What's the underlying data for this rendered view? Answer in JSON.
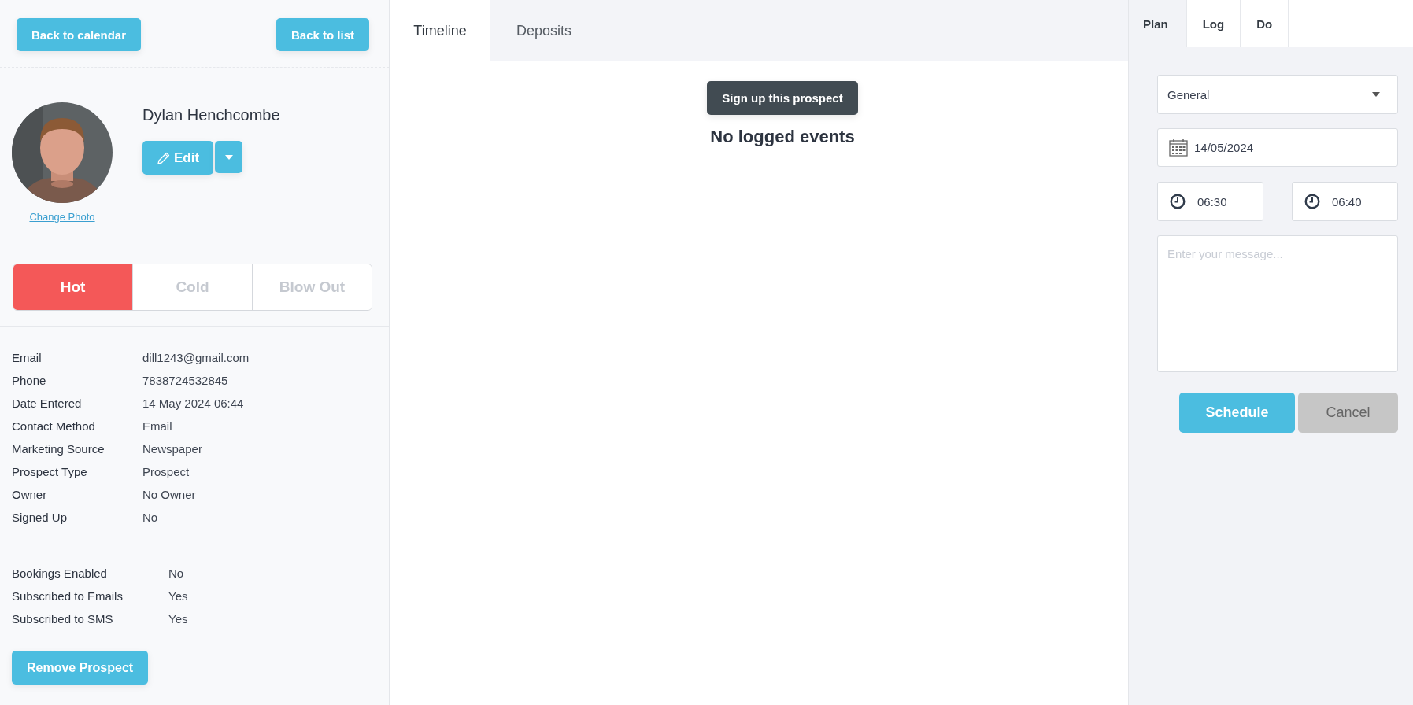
{
  "nav_buttons": [
    {
      "label": "Back to calendar"
    },
    {
      "label": "Back to list"
    }
  ],
  "profile": {
    "name": "Dylan Henchcombe",
    "edit_button": "Edit",
    "change_photo_link": "Change Photo"
  },
  "temperature": [
    {
      "label": "Hot",
      "selected": true
    },
    {
      "label": "Cold",
      "selected": false
    },
    {
      "label": "Blow Out",
      "selected": false
    }
  ],
  "details": [
    {
      "label": "Email",
      "value": "dill1243@gmail.com"
    },
    {
      "label": "Phone",
      "value": "7838724532845"
    },
    {
      "label": "Date Entered",
      "value": "14 May 2024 06:44"
    },
    {
      "label": "Contact Method",
      "value": "Email"
    },
    {
      "label": "Marketing Source",
      "value": "Newspaper"
    },
    {
      "label": "Prospect Type",
      "value": "Prospect"
    },
    {
      "label": "Owner",
      "value": "No Owner"
    },
    {
      "label": "Signed Up",
      "value": "No"
    }
  ],
  "settings": [
    {
      "label": "Bookings Enabled",
      "value": "No"
    },
    {
      "label": "Subscribed to Emails",
      "value": "Yes"
    },
    {
      "label": "Subscribed to SMS",
      "value": "Yes"
    }
  ],
  "remove_button": "Remove Prospect",
  "center_tabs": [
    {
      "label": "Timeline",
      "selected": true
    },
    {
      "label": "Deposits",
      "selected": false
    }
  ],
  "sign_up_button": "Sign up this prospect",
  "empty_message": "No logged events",
  "right_tabs": [
    {
      "label": "Plan",
      "selected": true
    },
    {
      "label": "Log",
      "selected": false
    },
    {
      "label": "Do",
      "selected": false
    }
  ],
  "form": {
    "type_select": "General",
    "date": "14/05/2024",
    "start_time": "06:30",
    "end_time": "06:40",
    "message_placeholder": "Enter your message...",
    "buttons": [
      {
        "label": "Schedule",
        "kind": "primary"
      },
      {
        "label": "Cancel",
        "kind": "secondary"
      }
    ]
  }
}
